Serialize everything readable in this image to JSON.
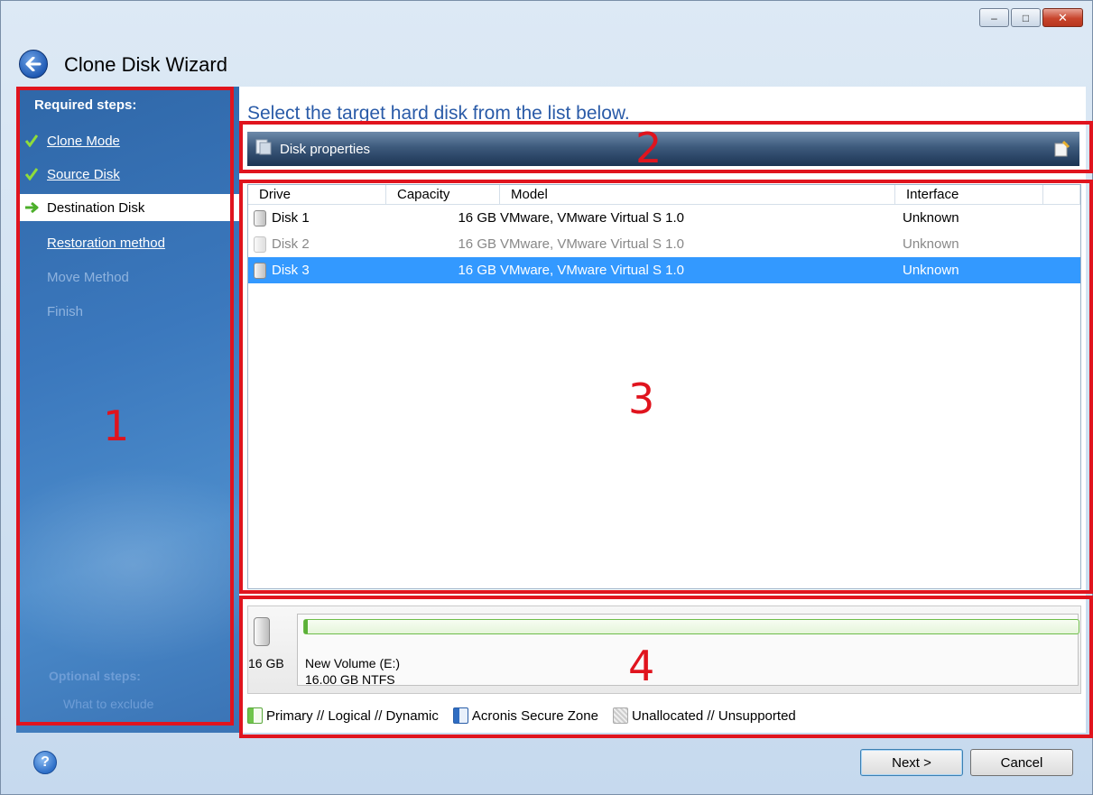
{
  "window": {
    "title": "Clone Disk Wizard",
    "minimize_glyph": "–",
    "maximize_glyph": "□",
    "close_glyph": "✕"
  },
  "sidebar": {
    "heading": "Required steps:",
    "items": [
      {
        "label": "Clone Mode",
        "state": "done"
      },
      {
        "label": "Source Disk",
        "state": "done"
      },
      {
        "label": "Destination Disk",
        "state": "current"
      },
      {
        "label": "Restoration method",
        "state": "link"
      },
      {
        "label": "Move Method",
        "state": "disabled"
      },
      {
        "label": "Finish",
        "state": "disabled"
      }
    ],
    "optional_heading": "Optional steps:",
    "optional_item": "What to exclude"
  },
  "main": {
    "instruction": "Select the target hard disk from the list below.",
    "toolbar": {
      "label": "Disk properties"
    },
    "columns": [
      "Drive",
      "Capacity",
      "Model",
      "Interface"
    ],
    "rows": [
      {
        "drive": "Disk 1",
        "capacity": "16 GB",
        "model": "VMware, VMware Virtual S 1.0",
        "interface": "Unknown"
      },
      {
        "drive": "Disk 2",
        "capacity": "16 GB",
        "model": "VMware, VMware Virtual S 1.0",
        "interface": "Unknown"
      },
      {
        "drive": "Disk 3",
        "capacity": "16 GB",
        "model": "VMware, VMware Virtual S 1.0",
        "interface": "Unknown"
      }
    ],
    "disk_map": {
      "size": "16 GB",
      "volume_name": "New Volume (E:)",
      "volume_fs": "16.00 GB  NTFS"
    },
    "legend": [
      "Primary // Logical // Dynamic",
      "Acronis Secure Zone",
      "Unallocated // Unsupported"
    ]
  },
  "footer": {
    "help_glyph": "?",
    "next_label": "Next >",
    "cancel_label": "Cancel"
  },
  "annotations": [
    "1",
    "2",
    "3",
    "4"
  ],
  "colors": {
    "annotation": "#e0141e",
    "selection": "#3399ff",
    "instruction": "#2a5ba8",
    "sidebar": "#3b78bd"
  }
}
